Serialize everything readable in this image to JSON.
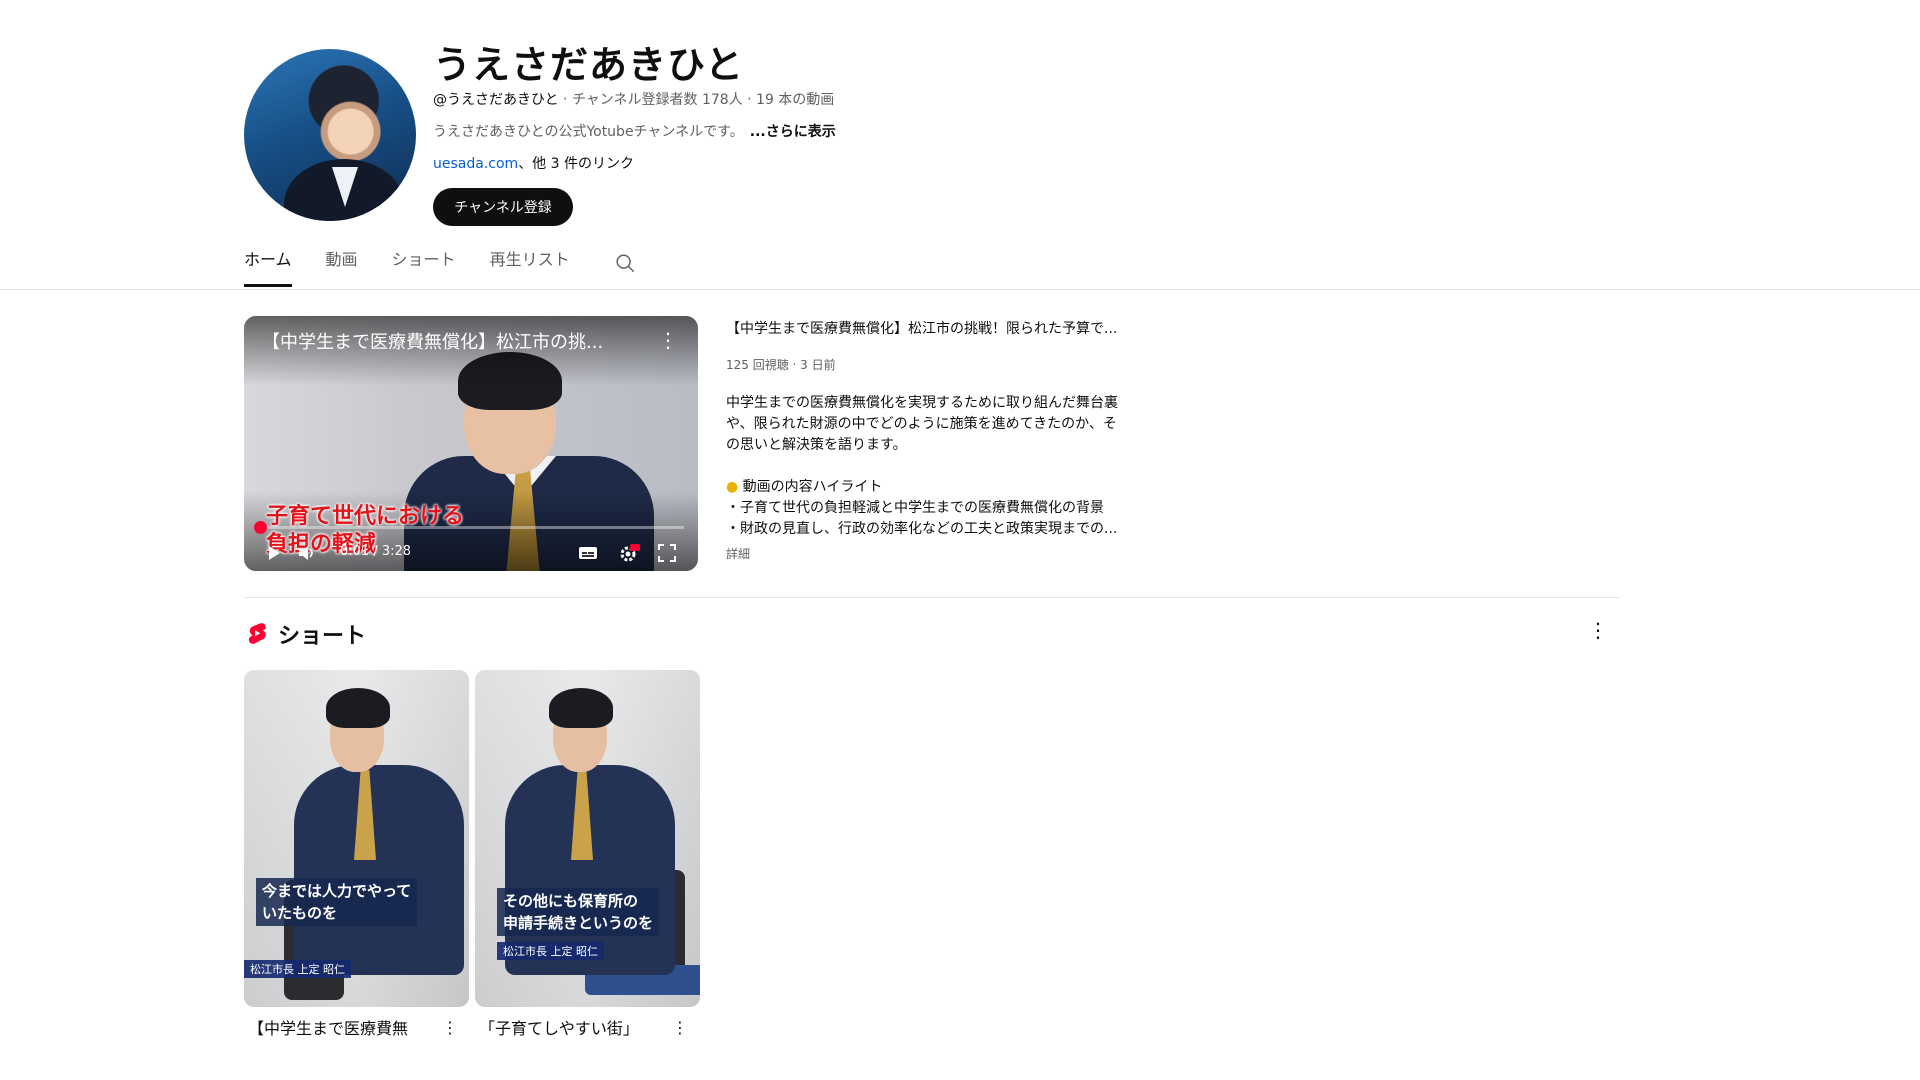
{
  "channel": {
    "name": "うえさだあきひと",
    "handle": "@うえさだあきひと",
    "meta_rest": " ‧ チャンネル登録者数 178人 ‧ 19 本の動画",
    "description": "うえさだあきひとの公式Yotubeチャンネルです。",
    "more_label": "...さらに表示",
    "link_text": "uesada.com",
    "other_links": "、他 3 件のリンク",
    "subscribe_label": "チャンネル登録"
  },
  "tabs": [
    {
      "label": "ホーム",
      "active": true
    },
    {
      "label": "動画",
      "active": false
    },
    {
      "label": "ショート",
      "active": false
    },
    {
      "label": "再生リスト",
      "active": false
    }
  ],
  "featured": {
    "player_title": "【中学生まで医療費無償化】松江市の挑...",
    "caption_line1": "子育て世代における",
    "caption_line2": "負担の軽減",
    "time": "0:01 / 3:28",
    "progress_fraction": 0.005,
    "title": "【中学生まで医療費無償化】松江市の挑戦！限られた予算で...",
    "stats": "125 回視聴 ‧ 3 日前",
    "desc_line1": "中学生までの医療費無償化を実現するために取り組んだ舞台裏",
    "desc_line2": "や、限られた財源の中でどのように施策を進めてきたのか、そ",
    "desc_line3": "の思いと解決策を語ります。",
    "highlight_heading": "動画の内容ハイライト",
    "highlight1": "・子育て世代の負担軽減と中学生までの医療費無償化の背景",
    "highlight2": "・財政の見直し、行政の効率化などの工夫と政策実現までの...",
    "details_label": "詳細"
  },
  "shorts": {
    "heading": "ショート",
    "items": [
      {
        "subtitle_line1": "今までは人力でやって",
        "subtitle_line2": "いたものを",
        "nameplate": "松江市長 上定 昭仁",
        "title": "【中学生まで医療費無"
      },
      {
        "subtitle_line1": "その他にも保育所の",
        "subtitle_line2": "申請手続きというのを",
        "nameplate": "松江市長 上定 昭仁",
        "title": "「子育てしやすい街」"
      }
    ]
  },
  "colors": {
    "accent_red": "#ff0033",
    "link_blue": "#065fd4",
    "text_secondary": "#606060"
  }
}
